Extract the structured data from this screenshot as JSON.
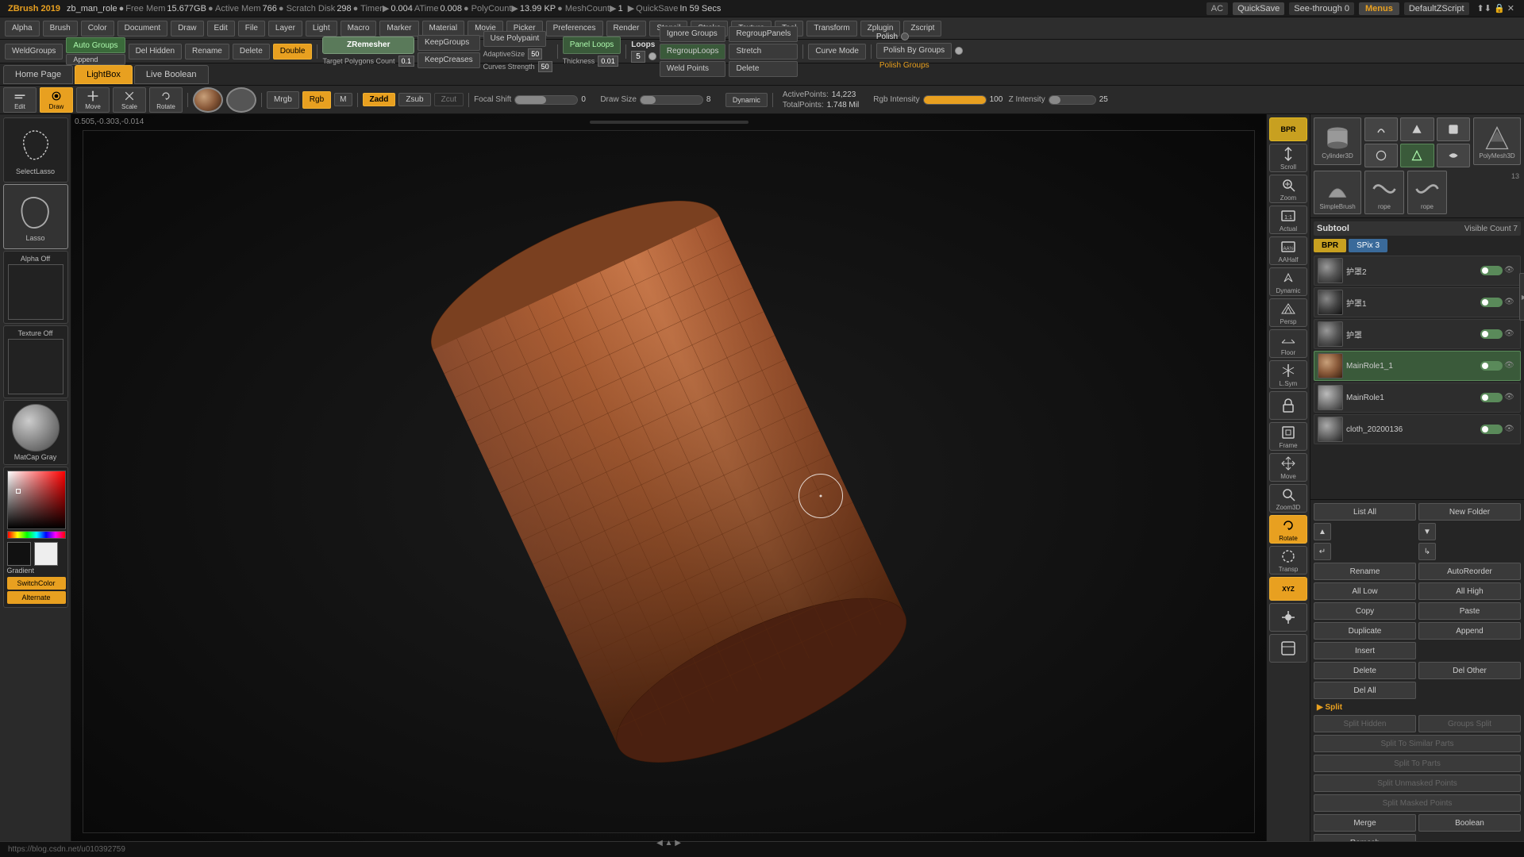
{
  "app": {
    "title": "ZBrush 2019",
    "filename": "zb_man_role",
    "modified": true,
    "free_mem": "15.677GB",
    "active_mem": "766",
    "scratch_disk": "298",
    "timer": "0.004",
    "atime": "0.008",
    "poly_count": "13.99 KP",
    "mesh_count": "1",
    "quick_save": "In 59 Secs"
  },
  "top_menu": {
    "items": [
      "Alpha",
      "Brush",
      "Color",
      "Document",
      "Draw",
      "Edit",
      "File",
      "Layer",
      "Light",
      "Macro",
      "Marker",
      "Material",
      "Movie",
      "Picker",
      "Preferences",
      "Render",
      "Stencil",
      "Stroke",
      "Texture",
      "Tool",
      "Transform",
      "Zplugin",
      "Zscript"
    ]
  },
  "right_corner": {
    "ac": "AC",
    "quick_save": "QuickSave",
    "see_through": "See-through 0",
    "menus": "Menus",
    "default_zscript": "DefaultZScript"
  },
  "second_toolbar": {
    "items": [
      "Alpha",
      "Brush",
      "Color",
      "Document",
      "Draw",
      "Edit",
      "File",
      "Layer",
      "Light",
      "Macro",
      "Marker",
      "Material",
      "Movie",
      "Picker",
      "Preferences",
      "Render",
      "Stencil",
      "Stroke",
      "Texture",
      "Tool",
      "Transform",
      "Zplugin",
      "Zscript"
    ],
    "weld_groups": "WeldGroups",
    "auto_groups": "Auto Groups",
    "del_hidden": "Del Hidden",
    "rename": "Rename",
    "keep_groups": "KeepGroups",
    "keep_creases": "KeepCreases",
    "use_polypaint": "Use Polypaint",
    "append": "Append",
    "delete_btn": "Delete",
    "double_btn": "Double"
  },
  "zremesher": {
    "label": "ZRemesher",
    "adaptive_size": "50",
    "curves_strength": "50",
    "target_polygons": "0.1",
    "panel_loops": "Panel Loops",
    "thickness": "0.01"
  },
  "loops": {
    "label": "Loops",
    "polish_val": "5",
    "ignore_groups": "Ignore Groups",
    "regroup_loops": "RegroupLoops",
    "weld_points": "Weld Points",
    "regroup_panels": "RegroupPanels",
    "stretch": "Stretch",
    "delete": "Delete"
  },
  "curve_mode": {
    "label": "Curve Mode"
  },
  "polish": {
    "label": "Polish",
    "polish_by_groups": "Polish By Groups",
    "groups_label": "Polish Groups"
  },
  "tabs": {
    "home": "Home Page",
    "lightbox": "LightBox",
    "live_boolean": "Live Boolean"
  },
  "brush_tools": {
    "edit": "Edit",
    "draw": "Draw",
    "move": "Move",
    "scale": "Scale",
    "rotate": "Rotate",
    "mrgb": "Mrgb",
    "rgb": "Rgb",
    "m_btn": "M",
    "zadd": "Zadd",
    "zsub": "Zsub",
    "zcut": "Zcut",
    "rgb_intensity": "100",
    "z_intensity": "25",
    "focal_shift": "0",
    "draw_size": "8",
    "dynamic": "Dynamic",
    "active_points": "14,223",
    "total_points": "1.748 Mil"
  },
  "left_panel": {
    "select_lasso": "SelectLasso",
    "lasso": "Lasso",
    "alpha_off": "Alpha Off",
    "texture_off": "Texture Off",
    "matcap_gray": "MatCap Gray",
    "gradient": "Gradient",
    "switch_color": "SwitchColor",
    "alternate": "Alternate"
  },
  "canvas": {
    "coords": "0.505,-0.303,-0.014"
  },
  "subtool": {
    "title": "Subtool",
    "visible_count": "Visible Count 7",
    "bpr": "BPR",
    "spix": "SPix 3",
    "items": [
      {
        "name": "护罩2",
        "visible": true,
        "active": false
      },
      {
        "name": "护罩1",
        "visible": true,
        "active": false
      },
      {
        "name": "护罩",
        "visible": true,
        "active": false
      },
      {
        "name": "MainRole1_1",
        "visible": true,
        "active": true
      },
      {
        "name": "MainRole1",
        "visible": true,
        "active": false
      },
      {
        "name": "cloth_20200136",
        "visible": true,
        "active": false
      }
    ]
  },
  "right_actions": {
    "list_all": "List All",
    "new_folder": "New Folder",
    "rename": "Rename",
    "auto_reorder": "AutoReorder",
    "all_low": "All Low",
    "all_high": "All High",
    "copy": "Copy",
    "paste": "Paste",
    "duplicate": "Duplicate",
    "append": "Append",
    "insert": "Insert",
    "delete": "Delete",
    "del_other": "Del Other",
    "del_all": "Del All",
    "split_section": "▶ Split",
    "split_hidden": "Split Hidden",
    "groups_split": "Groups Split",
    "split_to_similar": "Split To Similar Parts",
    "split_to_parts": "Split To Parts",
    "split_unmasked": "Split Unmasked Points",
    "split_masked": "Split Masked Points",
    "merge": "Merge",
    "boolean": "Boolean",
    "remesh": "Remesh"
  },
  "right_icons": {
    "bpr": "BPR",
    "scroll": "Scroll",
    "zoom": "Zoom",
    "actual": "Actual",
    "aahalf": "AAHalf",
    "dynamic": "Dynamic",
    "persp": "Persp",
    "floor": "Floor",
    "l_sym": "L.Sym",
    "lock": "🔒",
    "frame": "Frame",
    "move": "Move",
    "zoom3d": "Zoom3D",
    "rotate": "Rotate",
    "transp": "Transp",
    "xyz": "XYZ"
  },
  "bottom_url": "https://blog.csdn.net/u010392759"
}
